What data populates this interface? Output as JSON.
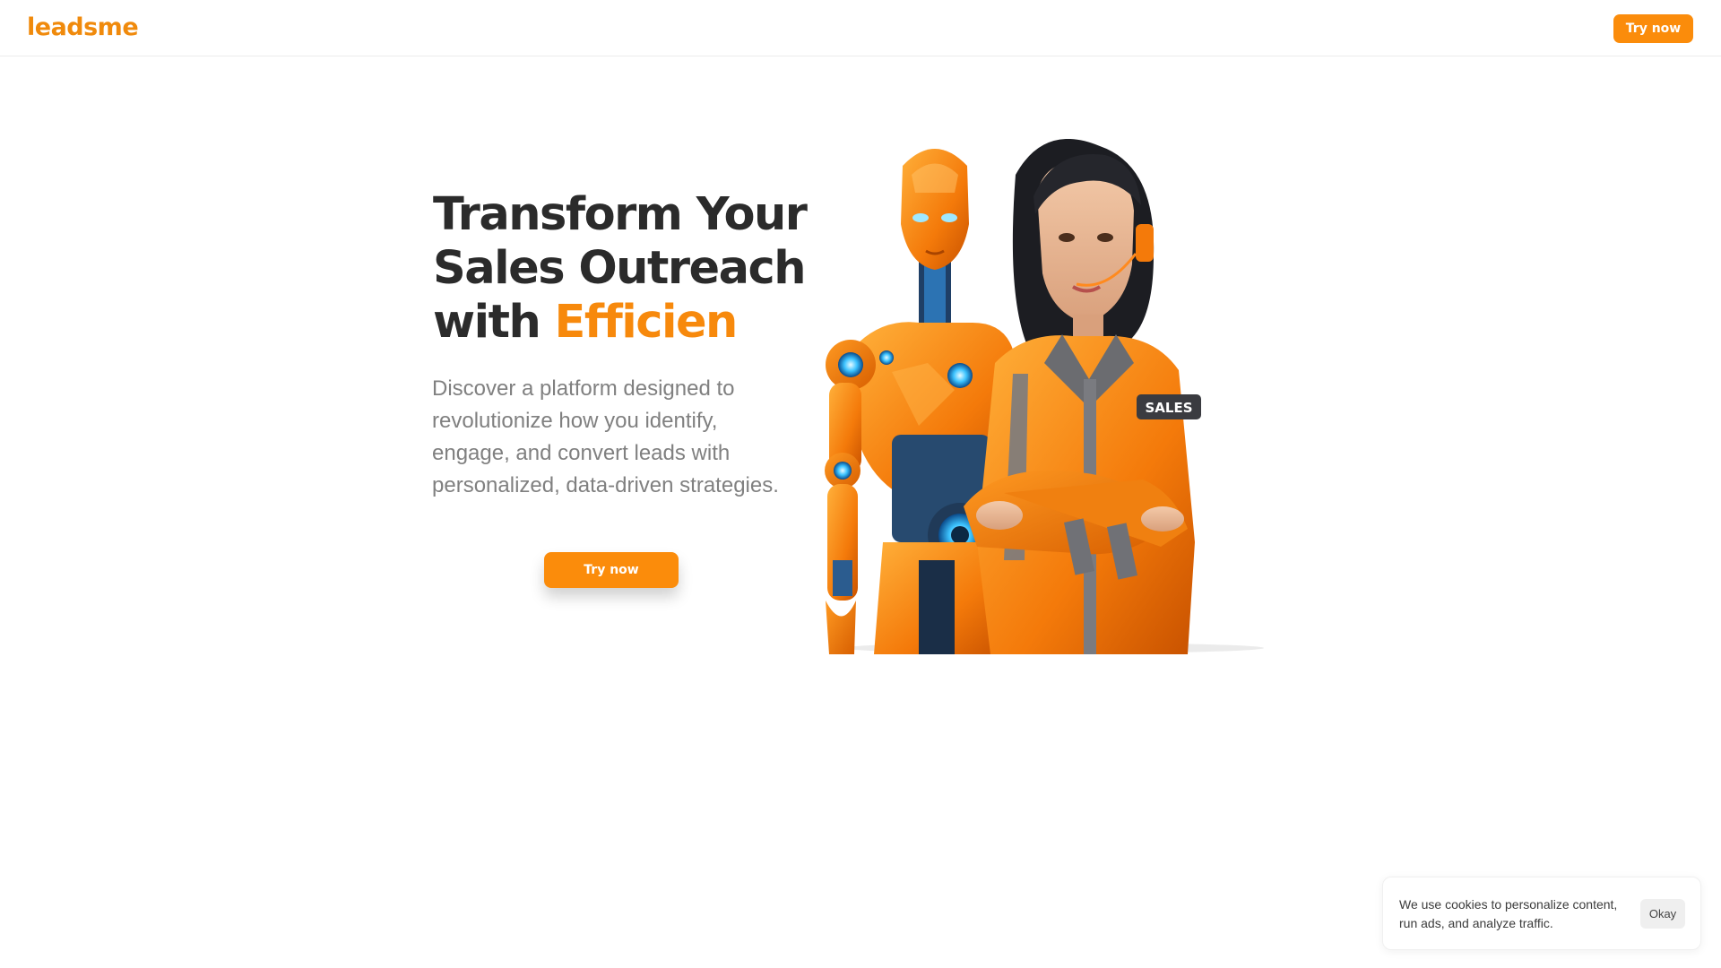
{
  "header": {
    "logo_text": "leadsme",
    "cta_label": "Try now"
  },
  "hero": {
    "title_line1": "Transform Your",
    "title_line2": "Sales Outreach",
    "title_line3_prefix": "with ",
    "title_line3_accent": "Efficien",
    "subtitle": "Discover a platform designed to revolutionize how you identify, engage, and convert leads with personalized, data-driven strategies.",
    "cta_label": "Try now",
    "image_badge": "SALES"
  },
  "cookie_banner": {
    "text": "We use cookies to personalize content, run ads, and analyze traffic.",
    "button_label": "Okay"
  },
  "colors": {
    "brand_orange": "#fb8c0b",
    "heading": "#2b2b2b",
    "body_text": "#808080"
  }
}
